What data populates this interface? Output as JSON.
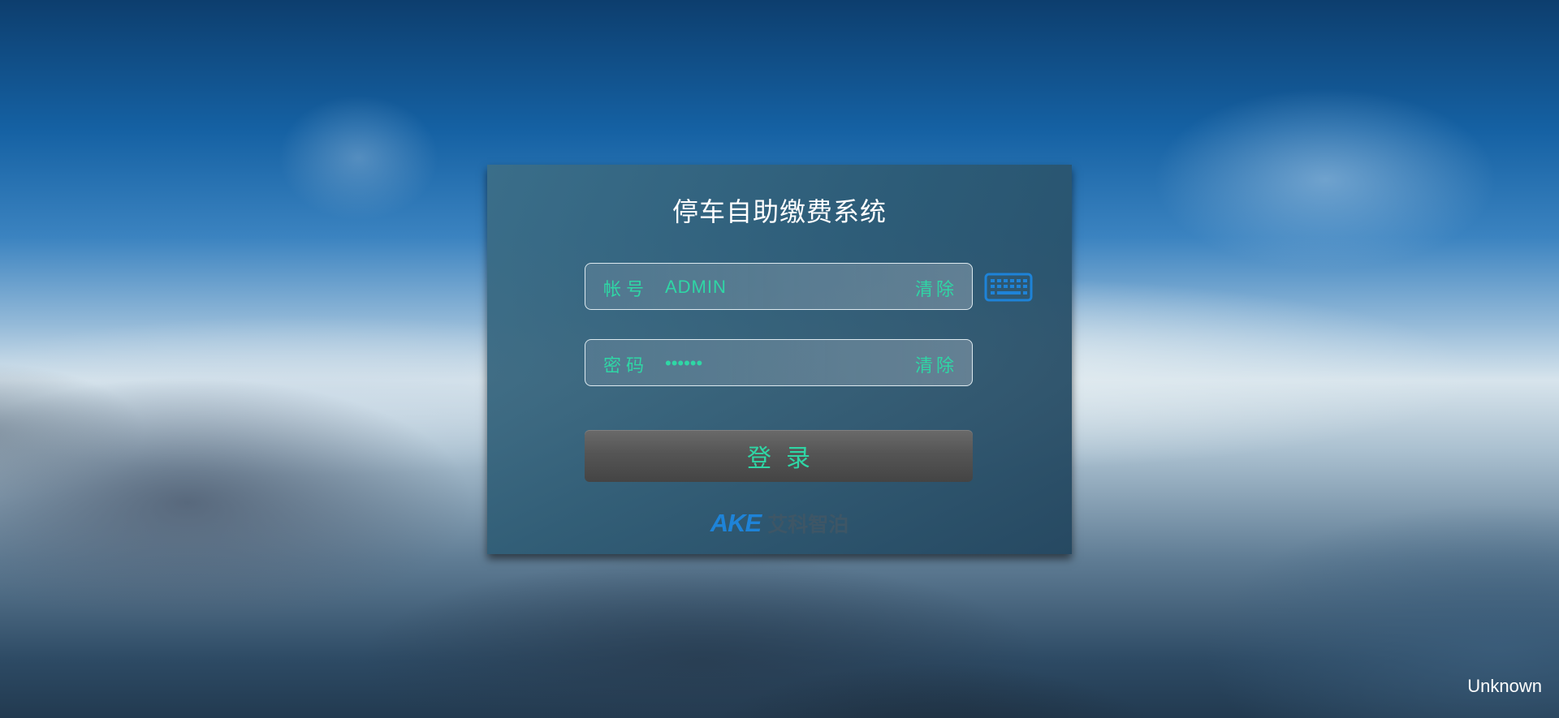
{
  "app": {
    "title": "停车自助缴费系统"
  },
  "login_form": {
    "account": {
      "label": "帐号",
      "value": "ADMIN",
      "clear_label": "清除"
    },
    "password": {
      "label": "密码",
      "value": "••••••",
      "clear_label": "清除"
    },
    "keyboard_icon": "keyboard-icon",
    "login_label": "登录"
  },
  "brand": {
    "logo_mark": "AKE",
    "logo_text": "艾科智泊"
  },
  "status": {
    "text": "Unknown"
  },
  "colors": {
    "accent": "#2fd6a5",
    "keyboard_icon": "#1e83d8",
    "logo_blue": "#1e83d8",
    "logo_text": "#3e5666",
    "button": "#555555"
  }
}
